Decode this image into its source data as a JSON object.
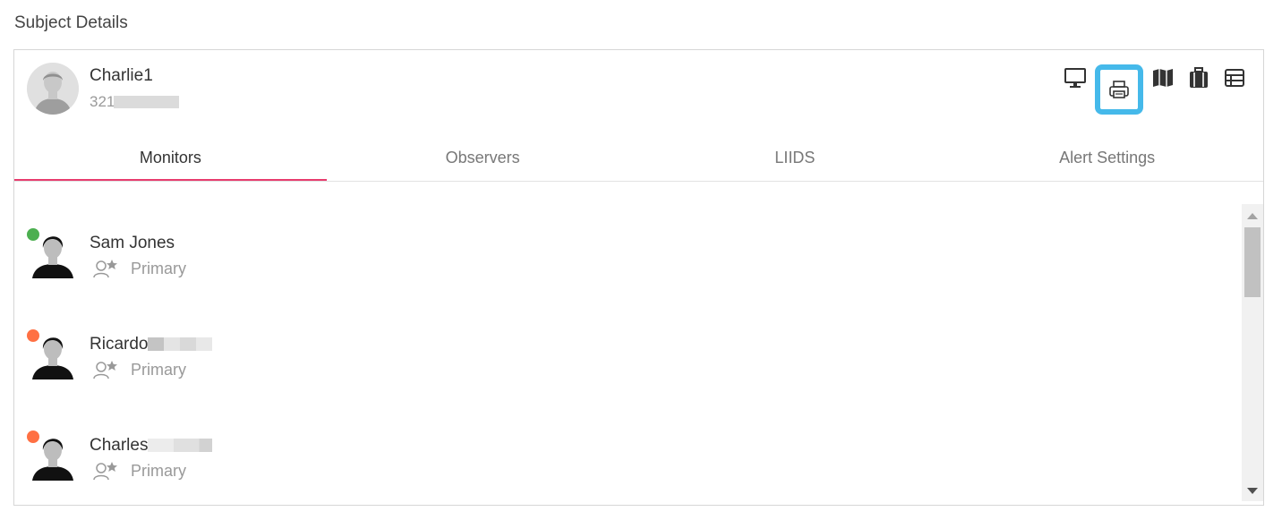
{
  "header": {
    "title": "Subject Details"
  },
  "subject": {
    "name": "Charlie1",
    "id_visible": "321"
  },
  "toolbar": {
    "icons": [
      "monitor-icon",
      "printer-icon",
      "map-icon",
      "luggage-icon",
      "table-icon"
    ],
    "active": "printer-icon",
    "highlight_color": "#45b9ea"
  },
  "tabs": [
    {
      "label": "Monitors",
      "active": true
    },
    {
      "label": "Observers",
      "active": false
    },
    {
      "label": "LIIDS",
      "active": false
    },
    {
      "label": "Alert Settings",
      "active": false
    }
  ],
  "accent_color": "#e73c6e",
  "monitors": [
    {
      "name": "Sam Jones",
      "role": "Primary",
      "status_color": "#4caf50"
    },
    {
      "name": "Ricardo",
      "role": "Primary",
      "status_color": "#ff7043"
    },
    {
      "name": "Charles",
      "role": "Primary",
      "status_color": "#ff7043"
    }
  ]
}
